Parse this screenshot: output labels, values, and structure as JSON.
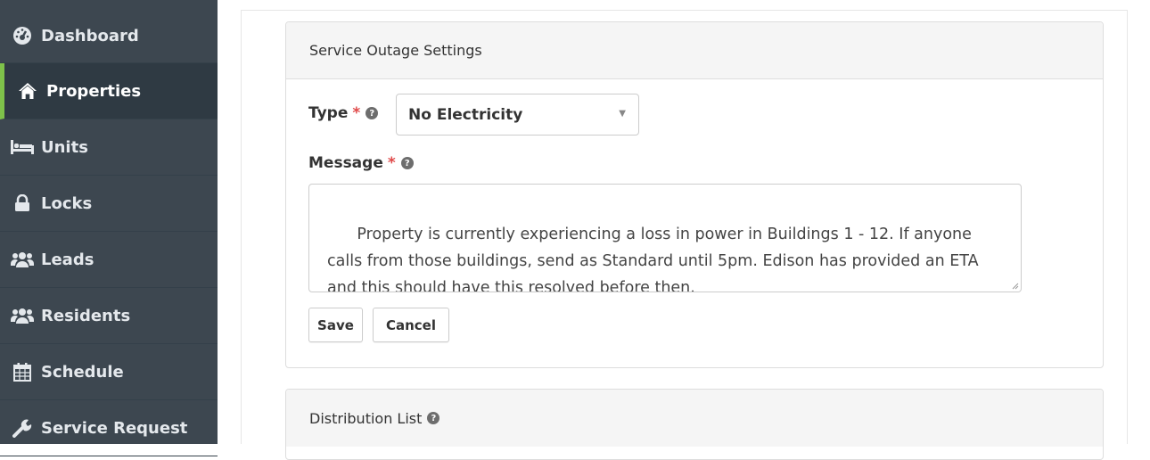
{
  "colors": {
    "sidebar_bg": "#3d4750",
    "active_accent": "#7ec24a",
    "required": "#e04a4a"
  },
  "sidebar": {
    "items": [
      {
        "label": "Dashboard",
        "icon": "dashboard-icon"
      },
      {
        "label": "Properties",
        "icon": "home-icon",
        "active": true
      },
      {
        "label": "Units",
        "icon": "bed-icon"
      },
      {
        "label": "Locks",
        "icon": "lock-icon"
      },
      {
        "label": "Leads",
        "icon": "users-icon"
      },
      {
        "label": "Residents",
        "icon": "users-icon"
      },
      {
        "label": "Schedule",
        "icon": "calendar-icon"
      },
      {
        "label": "Service Request",
        "icon": "wrench-icon"
      }
    ]
  },
  "outage_panel": {
    "title": "Service Outage Settings",
    "type_label": "Type",
    "type_required": "*",
    "type_value": "No Electricity",
    "message_label": "Message",
    "message_required": "*",
    "message_value": "Property is currently experiencing a loss in power in Buildings 1 - 12. If anyone calls from those buildings, send as Standard until 5pm. Edison has provided an ETA and this should have this resolved before then.",
    "save_label": "Save",
    "cancel_label": "Cancel"
  },
  "distribution_panel": {
    "title": "Distribution List"
  }
}
